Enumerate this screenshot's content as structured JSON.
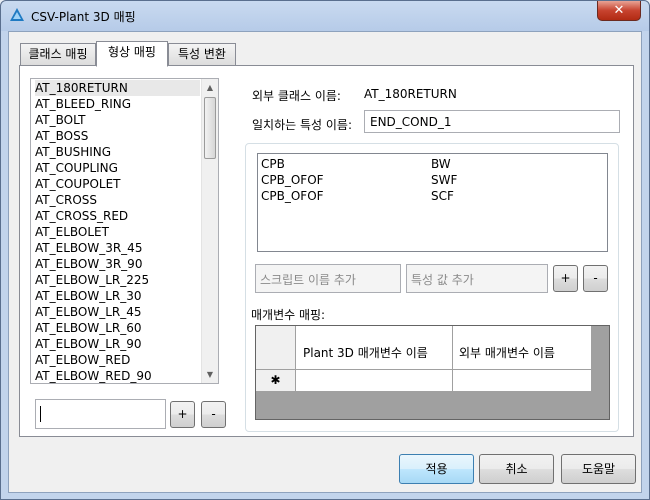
{
  "window": {
    "title": "CSV-Plant 3D 매핑",
    "close_glyph": "✕",
    "accent": "#c7432f"
  },
  "tabs": [
    {
      "label": "클래스 매핑",
      "active": false
    },
    {
      "label": "형상 매핑",
      "active": true
    },
    {
      "label": "특성 변환",
      "active": false
    }
  ],
  "class_list": {
    "items": [
      "AT_180RETURN",
      "AT_BLEED_RING",
      "AT_BOLT",
      "AT_BOSS",
      "AT_BUSHING",
      "AT_COUPLING",
      "AT_COUPOLET",
      "AT_CROSS",
      "AT_CROSS_RED",
      "AT_ELBOLET",
      "AT_ELBOW_3R_45",
      "AT_ELBOW_3R_90",
      "AT_ELBOW_LR_225",
      "AT_ELBOW_LR_30",
      "AT_ELBOW_LR_45",
      "AT_ELBOW_LR_60",
      "AT_ELBOW_LR_90",
      "AT_ELBOW_RED",
      "AT_ELBOW_RED_90"
    ],
    "selected": "AT_180RETURN",
    "new_value": "",
    "add_label": "+",
    "remove_label": "-"
  },
  "details": {
    "external_class_label": "외부 클래스 이름:",
    "external_class_value": "AT_180RETURN",
    "match_prop_label": "일치하는 특성 이름:",
    "match_prop_value": "END_COND_1"
  },
  "value_map": {
    "rows": [
      {
        "script": "CPB",
        "value": "BW"
      },
      {
        "script": "CPB_OFOF",
        "value": "SWF"
      },
      {
        "script": "CPB_OFOF",
        "value": "SCF"
      }
    ],
    "script_placeholder": "스크립트 이름 추가",
    "value_placeholder": "특성 값 추가",
    "add_label": "+",
    "remove_label": "-"
  },
  "param_map": {
    "label": "매개변수 매핑:",
    "columns": [
      "Plant 3D 매개변수 이름",
      "외부 매개변수 이름"
    ],
    "new_row_marker": "✱"
  },
  "footer": {
    "apply": "적용",
    "cancel": "취소",
    "help": "도움말"
  }
}
